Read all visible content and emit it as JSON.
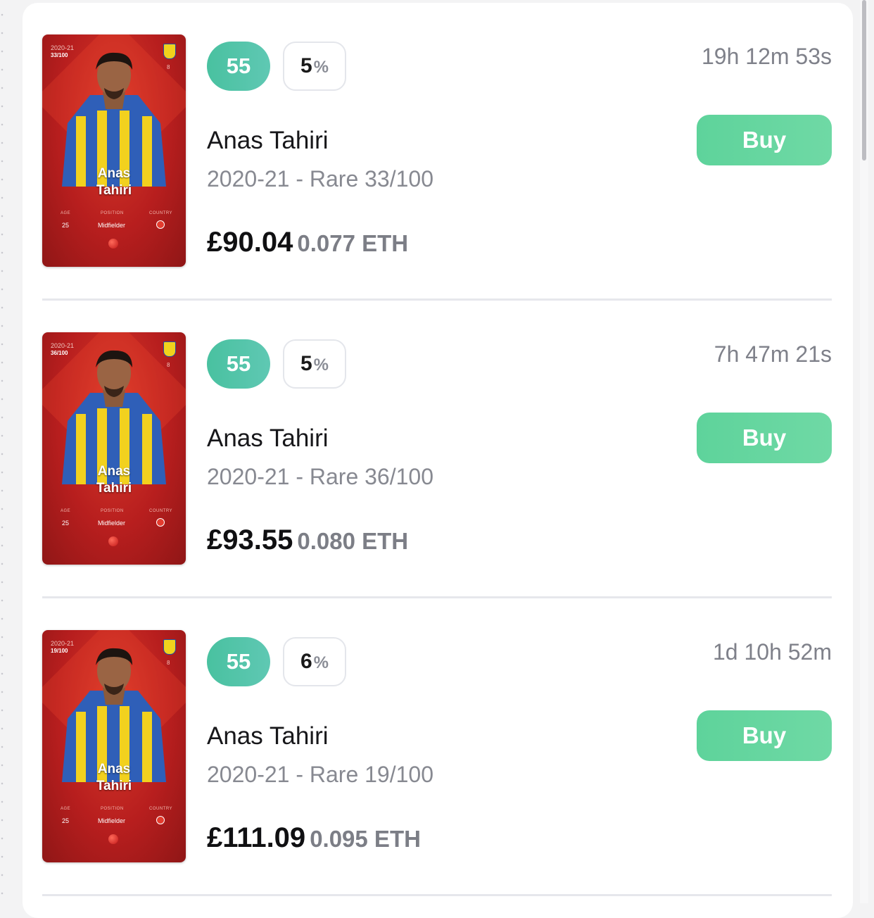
{
  "listings": [
    {
      "card": {
        "season": "2020-21",
        "serial": "33/100",
        "shirt_number": "8",
        "name_line1": "Anas",
        "name_line2": "Tahiri",
        "age_label": "AGE",
        "position_label": "POSITION",
        "country_label": "COUNTRY",
        "age": "25",
        "position": "Midfielder"
      },
      "score": "55",
      "bonus_value": "5",
      "bonus_symbol": "%",
      "player_name": "Anas Tahiri",
      "edition": "2020-21 - Rare 33/100",
      "price": "£90.04",
      "eth": "0.077 ETH",
      "time_left": "19h 12m 53s",
      "buy_label": "Buy"
    },
    {
      "card": {
        "season": "2020-21",
        "serial": "36/100",
        "shirt_number": "8",
        "name_line1": "Anas",
        "name_line2": "Tahiri",
        "age_label": "AGE",
        "position_label": "POSITION",
        "country_label": "COUNTRY",
        "age": "25",
        "position": "Midfielder"
      },
      "score": "55",
      "bonus_value": "5",
      "bonus_symbol": "%",
      "player_name": "Anas Tahiri",
      "edition": "2020-21 - Rare 36/100",
      "price": "£93.55",
      "eth": "0.080 ETH",
      "time_left": "7h 47m 21s",
      "buy_label": "Buy"
    },
    {
      "card": {
        "season": "2020-21",
        "serial": "19/100",
        "shirt_number": "8",
        "name_line1": "Anas",
        "name_line2": "Tahiri",
        "age_label": "AGE",
        "position_label": "POSITION",
        "country_label": "COUNTRY",
        "age": "25",
        "position": "Midfielder"
      },
      "score": "55",
      "bonus_value": "6",
      "bonus_symbol": "%",
      "player_name": "Anas Tahiri",
      "edition": "2020-21 - Rare 19/100",
      "price": "£111.09",
      "eth": "0.095 ETH",
      "time_left": "1d 10h 52m",
      "buy_label": "Buy"
    }
  ],
  "colors": {
    "card_red": "#b71e1e",
    "score_teal": "#49c1a0",
    "buy_green": "#5ed39b"
  }
}
